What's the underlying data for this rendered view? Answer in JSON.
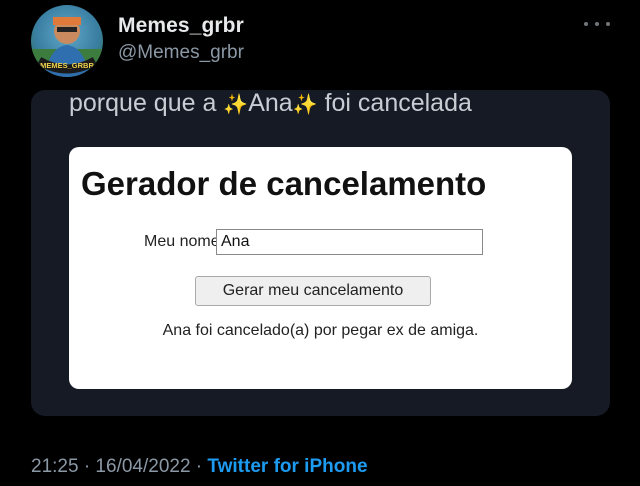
{
  "tweet": {
    "display_name": "Memes_grbr",
    "handle": "@Memes_grbr",
    "avatar_text": "MEMES_GRBR",
    "timestamp": "21:25 · 16/04/2022 ·",
    "source": "Twitter for iPhone"
  },
  "media": {
    "caption_before": "porque que a",
    "caption_name": "Ana",
    "caption_after": "foi cancelada",
    "sparkle": "✨",
    "app": {
      "title": "Gerador de cancelamento",
      "name_label": "Meu nome:",
      "name_value": "Ana",
      "button_label": "Gerar meu cancelamento",
      "result": "Ana foi cancelado(a) por pegar ex de amiga."
    }
  },
  "icons": {
    "more": "more-horizontal-icon",
    "avatar": "avatar-illustration"
  },
  "colors": {
    "background": "#000000",
    "accent": "#1d9bf0",
    "muted": "#8b98a5",
    "media_bg": "#161a24"
  }
}
